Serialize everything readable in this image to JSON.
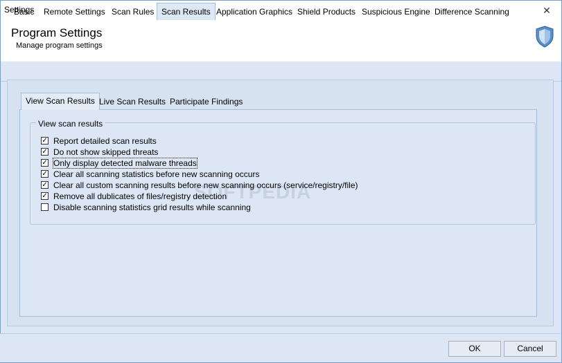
{
  "window": {
    "title": "Settings",
    "close_glyph": "✕"
  },
  "header": {
    "title": "Program Settings",
    "subtitle": "Manage program settings",
    "icon": "shield-icon"
  },
  "tabs": [
    {
      "label": "Basic"
    },
    {
      "label": "Remote Settings"
    },
    {
      "label": "Scan Rules"
    },
    {
      "label": "Scan Results",
      "selected": true
    },
    {
      "label": "Application Graphics"
    },
    {
      "label": "Shield Products"
    },
    {
      "label": "Suspicious Engine"
    },
    {
      "label": "Difference Scanning"
    }
  ],
  "subtabs": [
    {
      "label": "View Scan Results",
      "selected": true
    },
    {
      "label": "Live Scan Results"
    },
    {
      "label": "Participate Findings"
    }
  ],
  "group": {
    "label": "View scan results",
    "options": [
      {
        "label": "Report detailed scan results",
        "checked": true
      },
      {
        "label": "Do not show skipped threats",
        "checked": true
      },
      {
        "label": "Only display detected malware threads",
        "checked": true,
        "focused": true
      },
      {
        "label": "Clear all scanning statistics before new scanning occurs",
        "checked": true
      },
      {
        "label": "Clear all custom scanning results before new scanning occurs (service/registry/file)",
        "checked": true
      },
      {
        "label": "Remove all dublicates of files/registry detection",
        "checked": true
      },
      {
        "label": "Disable scanning statistics grid results while scanning",
        "checked": false
      }
    ]
  },
  "watermark": "SOFTPEDIA",
  "buttons": {
    "ok": "OK",
    "cancel": "Cancel"
  },
  "colors": {
    "background": "#dce6f4",
    "border": "#a7bcd8",
    "accent": "#5b8fc7"
  }
}
